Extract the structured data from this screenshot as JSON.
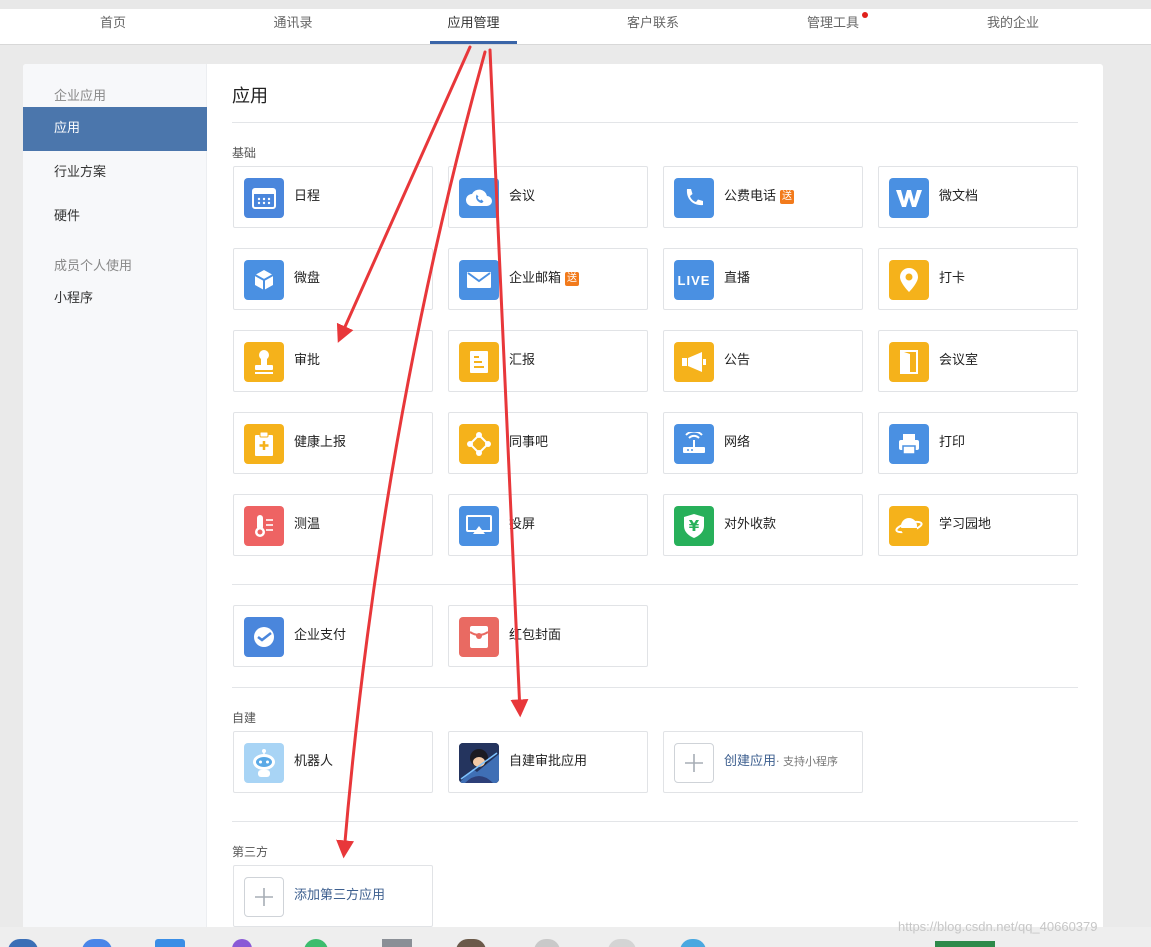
{
  "nav": {
    "tabs": [
      {
        "label": "首页"
      },
      {
        "label": "通讯录"
      },
      {
        "label": "应用管理",
        "active": true
      },
      {
        "label": "客户联系"
      },
      {
        "label": "管理工具",
        "dot": true
      },
      {
        "label": "我的企业"
      }
    ]
  },
  "sidebar": {
    "group_enterprise": "企业应用",
    "items_enterprise": [
      "应用",
      "行业方案",
      "硬件"
    ],
    "group_personal": "成员个人使用",
    "items_personal": [
      "小程序"
    ]
  },
  "main": {
    "title": "应用",
    "sections": {
      "basic": "基础",
      "self_built": "自建",
      "third_party": "第三方"
    },
    "basic_apps": [
      {
        "name": "日程",
        "icon": "calendar-icon"
      },
      {
        "name": "会议",
        "icon": "cloud-phone-icon"
      },
      {
        "name": "公费电话",
        "icon": "phone-icon",
        "badge": "送"
      },
      {
        "name": "微文档",
        "icon": "w-doc-icon"
      },
      {
        "name": "微盘",
        "icon": "cube-drive-icon"
      },
      {
        "name": "企业邮箱",
        "icon": "mail-icon",
        "badge": "送"
      },
      {
        "name": "直播",
        "icon": "live-icon",
        "icon_text": "LIVE"
      },
      {
        "name": "打卡",
        "icon": "location-pin-icon"
      },
      {
        "name": "审批",
        "icon": "stamp-icon"
      },
      {
        "name": "汇报",
        "icon": "report-doc-icon"
      },
      {
        "name": "公告",
        "icon": "megaphone-icon"
      },
      {
        "name": "会议室",
        "icon": "door-icon"
      },
      {
        "name": "健康上报",
        "icon": "health-clipboard-icon"
      },
      {
        "name": "同事吧",
        "icon": "network-nodes-icon"
      },
      {
        "name": "网络",
        "icon": "router-icon"
      },
      {
        "name": "打印",
        "icon": "printer-icon"
      },
      {
        "name": "测温",
        "icon": "thermometer-icon"
      },
      {
        "name": "投屏",
        "icon": "screen-cast-icon"
      },
      {
        "name": "对外收款",
        "icon": "yuan-shield-icon",
        "icon_text": "¥"
      },
      {
        "name": "学习园地",
        "icon": "planet-icon"
      }
    ],
    "extra_apps": [
      {
        "name": "企业支付",
        "icon": "payment-icon"
      },
      {
        "name": "红包封面",
        "icon": "red-packet-icon"
      }
    ],
    "self_built_apps": [
      {
        "name": "机器人",
        "icon": "robot-icon"
      },
      {
        "name": "自建审批应用",
        "icon": "custom-app-avatar-icon"
      },
      {
        "name": "创建应用",
        "sub": "· 支持小程序",
        "icon": "plus-icon"
      }
    ],
    "third_party_apps": [
      {
        "name": "添加第三方应用",
        "icon": "plus-icon"
      }
    ]
  },
  "watermark": "https://blog.csdn.net/qq_40660379",
  "colors": {
    "accent": "#4b76ac",
    "nav_active_underline": "#3a65a8",
    "annotation_arrow": "#e8373a",
    "badge": "#f27a1b"
  }
}
